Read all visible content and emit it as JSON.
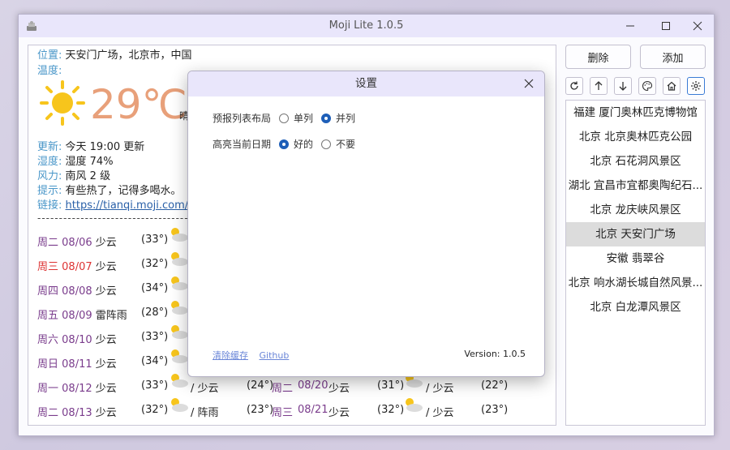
{
  "window": {
    "title": "Moji Lite 1.0.5"
  },
  "current": {
    "location_label": "位置:",
    "location": "天安门广场，北京市，中国",
    "humidity_label": "温度:",
    "temperature": "29℃",
    "temp_tail": "晴",
    "update_label": "更新:",
    "update": "今天 19:00 更新",
    "humid_label": "湿度:",
    "humid": "湿度 74%",
    "wind_label": "风力:",
    "wind": "南风 2 级",
    "tip_label": "提示:",
    "tip": "有些热了，记得多喝水。",
    "link_label": "链接:",
    "link": "https://tianqi.moji.com/weather/china/beijing/tiananmen"
  },
  "separator": "--------------------------------------------------------------------------------------------------------------",
  "forecast": [
    {
      "day": "周二",
      "date": "08/06",
      "desc": "少云",
      "temp": "(33°)",
      "red": false
    },
    {
      "day": "周三",
      "date": "08/07",
      "desc": "少云",
      "temp": "(32°)",
      "red": true
    },
    {
      "day": "周四",
      "date": "08/08",
      "desc": "少云",
      "temp": "(34°)",
      "red": false
    },
    {
      "day": "周五",
      "date": "08/09",
      "desc": "雷阵雨",
      "temp": "(28°)",
      "red": false
    },
    {
      "day": "周六",
      "date": "08/10",
      "desc": "少云",
      "temp": "(33°)",
      "red": false
    },
    {
      "day": "周日",
      "date": "08/11",
      "desc": "少云",
      "temp": "(34°)",
      "red": false
    },
    {
      "day": "周一",
      "date": "08/12",
      "desc": "少云",
      "temp": "(33°)",
      "red": false
    },
    {
      "day": "周二",
      "date": "08/13",
      "desc": "少云",
      "temp": "(32°)",
      "red": false
    }
  ],
  "forecast_tail": [
    {
      "night": "/ 少云",
      "ntemp": "(24°)",
      "day2": "周二",
      "date2": "08/20",
      "desc2": "少云",
      "temp2": "(31°)",
      "night2": "/ 少云",
      "ntemp2": "(22°)"
    },
    {
      "night": "/ 阵雨",
      "ntemp": "(23°)",
      "day2": "周三",
      "date2": "08/21",
      "desc2": "少云",
      "temp2": "(32°)",
      "night2": "/ 少云",
      "ntemp2": "(23°)"
    }
  ],
  "sidebar": {
    "delete_label": "删除",
    "add_label": "添加",
    "locations": [
      "福建 厦门奥林匹克博物馆",
      "北京 北京奥林匹克公园",
      "北京 石花洞风景区",
      "湖北 宜昌市宜都奥陶纪石...",
      "北京 龙庆峡风景区",
      "北京 天安门广场",
      "安徽 翡翠谷",
      "北京 响水湖长城自然风景...",
      "北京 白龙潭风景区"
    ],
    "selected_index": 5
  },
  "dialog": {
    "title": "设置",
    "layout_label": "预报列表布局",
    "layout_opt1": "单列",
    "layout_opt2": "并列",
    "layout_selected": "并列",
    "highlight_label": "高亮当前日期",
    "highlight_opt1": "好的",
    "highlight_opt2": "不要",
    "highlight_selected": "好的",
    "clear_cache": "清除缓存",
    "github": "Github",
    "version": "Version: 1.0.5"
  },
  "colors": {
    "accent": "#e9e6fb",
    "temp": "#e8a07a",
    "label": "#4a97c9",
    "weekday": "#7a3c8c",
    "today_red": "#dd3333",
    "radio": "#1e5fb8"
  }
}
